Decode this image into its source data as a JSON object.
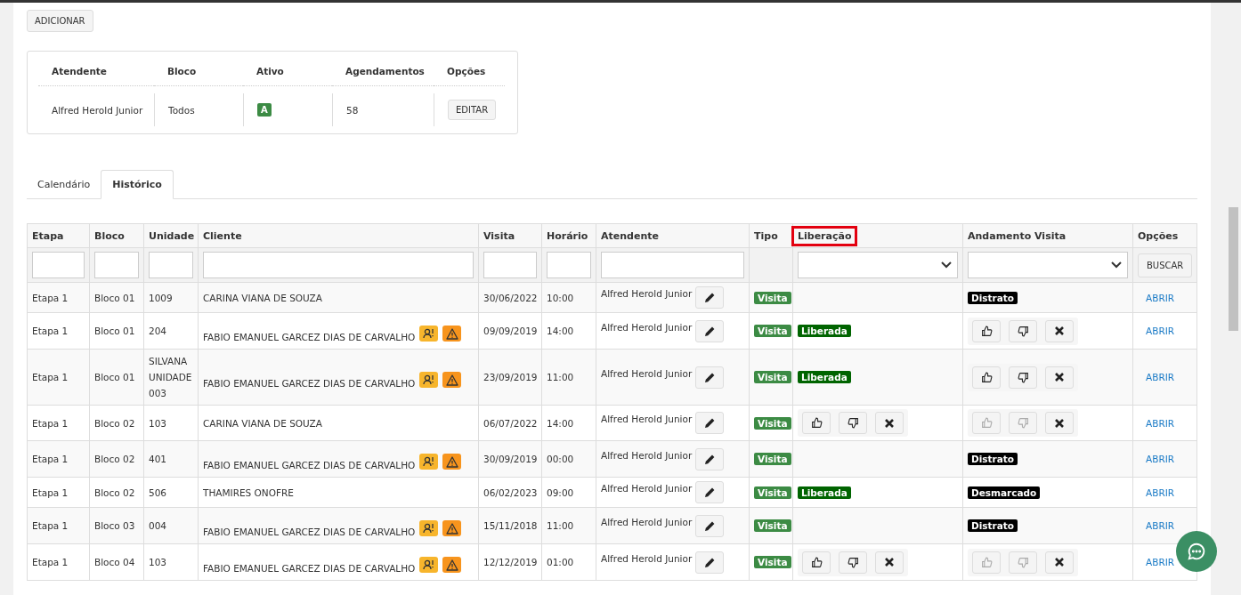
{
  "add_button": "ADICIONAR",
  "summary": {
    "columns": [
      "Atendente",
      "Bloco",
      "Ativo",
      "Agendamentos",
      "Opções"
    ],
    "row": {
      "atendente": "Alfred Herold Junior",
      "bloco": "Todos",
      "ativo": "A",
      "agendamentos": "58",
      "button": "EDITAR"
    }
  },
  "tabs": [
    {
      "label": "Calendário",
      "selected": false
    },
    {
      "label": "Histórico",
      "selected": true
    }
  ],
  "table": {
    "columns": [
      {
        "label": "Etapa",
        "kind": "input",
        "highlighted": false
      },
      {
        "label": "Bloco",
        "kind": "input",
        "highlighted": false
      },
      {
        "label": "Unidade",
        "kind": "input",
        "highlighted": false
      },
      {
        "label": "Cliente",
        "kind": "input",
        "highlighted": false
      },
      {
        "label": "Visita",
        "kind": "input",
        "highlighted": false
      },
      {
        "label": "Horário",
        "kind": "input",
        "highlighted": false
      },
      {
        "label": "Atendente",
        "kind": "input",
        "highlighted": false
      },
      {
        "label": "Tipo",
        "kind": "none",
        "highlighted": false
      },
      {
        "label": "Liberação",
        "kind": "select",
        "highlighted": true
      },
      {
        "label": "Andamento Visita",
        "kind": "select",
        "highlighted": false
      },
      {
        "label": "Opções",
        "kind": "button",
        "highlighted": false
      }
    ],
    "search_button": "BUSCAR",
    "rows": [
      {
        "etapa": "Etapa 1",
        "bloco": "Bloco 01",
        "unidade": "1009",
        "cliente": "CARINA VIANA DE SOUZA",
        "alerts": false,
        "visita": "30/06/2022",
        "horario": "10:00",
        "atendente": "Alfred Herold Junior",
        "tipo": "Visita",
        "liberacao": {
          "kind": "none"
        },
        "andamento": {
          "kind": "badge",
          "label": "Distrato"
        },
        "link": "ABRIR"
      },
      {
        "etapa": "Etapa 1",
        "bloco": "Bloco 01",
        "unidade": "204",
        "cliente": "FABIO EMANUEL GARCEZ DIAS DE CARVALHO",
        "alerts": true,
        "visita": "09/09/2019",
        "horario": "14:00",
        "atendente": "Alfred Herold Junior",
        "tipo": "Visita",
        "liberacao": {
          "kind": "badge",
          "label": "Liberada"
        },
        "andamento": {
          "kind": "actions",
          "disabled": false
        },
        "link": "ABRIR"
      },
      {
        "etapa": "Etapa 1",
        "bloco": "Bloco 01",
        "unidade": "SILVANA UNIDADE 003",
        "cliente": "FABIO EMANUEL GARCEZ DIAS DE CARVALHO",
        "alerts": true,
        "visita": "23/09/2019",
        "horario": "11:00",
        "atendente": "Alfred Herold Junior",
        "tipo": "Visita",
        "liberacao": {
          "kind": "badge",
          "label": "Liberada"
        },
        "andamento": {
          "kind": "actions",
          "disabled": false
        },
        "link": "ABRIR"
      },
      {
        "etapa": "Etapa 1",
        "bloco": "Bloco 02",
        "unidade": "103",
        "cliente": "CARINA VIANA DE SOUZA",
        "alerts": false,
        "visita": "06/07/2022",
        "horario": "14:00",
        "atendente": "Alfred Herold Junior",
        "tipo": "Visita",
        "liberacao": {
          "kind": "actions",
          "disabled": false
        },
        "andamento": {
          "kind": "actions",
          "disabled": true
        },
        "link": "ABRIR"
      },
      {
        "etapa": "Etapa 1",
        "bloco": "Bloco 02",
        "unidade": "401",
        "cliente": "FABIO EMANUEL GARCEZ DIAS DE CARVALHO",
        "alerts": true,
        "visita": "30/09/2019",
        "horario": "00:00",
        "atendente": "Alfred Herold Junior",
        "tipo": "Visita",
        "liberacao": {
          "kind": "none"
        },
        "andamento": {
          "kind": "badge",
          "label": "Distrato"
        },
        "link": "ABRIR"
      },
      {
        "etapa": "Etapa 1",
        "bloco": "Bloco 02",
        "unidade": "506",
        "cliente": "THAMIRES ONOFRE",
        "alerts": false,
        "visita": "06/02/2023",
        "horario": "09:00",
        "atendente": "Alfred Herold Junior",
        "tipo": "Visita",
        "liberacao": {
          "kind": "badge",
          "label": "Liberada"
        },
        "andamento": {
          "kind": "badge",
          "label": "Desmarcado"
        },
        "link": "ABRIR"
      },
      {
        "etapa": "Etapa 1",
        "bloco": "Bloco 03",
        "unidade": "004",
        "cliente": "FABIO EMANUEL GARCEZ DIAS DE CARVALHO",
        "alerts": true,
        "visita": "15/11/2018",
        "horario": "11:00",
        "atendente": "Alfred Herold Junior",
        "tipo": "Visita",
        "liberacao": {
          "kind": "none"
        },
        "andamento": {
          "kind": "badge",
          "label": "Distrato"
        },
        "link": "ABRIR"
      },
      {
        "etapa": "Etapa 1",
        "bloco": "Bloco 04",
        "unidade": "103",
        "cliente": "FABIO EMANUEL GARCEZ DIAS DE CARVALHO",
        "alerts": true,
        "visita": "12/12/2019",
        "horario": "01:00",
        "atendente": "Alfred Herold Junior",
        "tipo": "Visita",
        "liberacao": {
          "kind": "actions",
          "disabled": false
        },
        "andamento": {
          "kind": "actions",
          "disabled": true
        },
        "link": "ABRIR"
      }
    ]
  }
}
